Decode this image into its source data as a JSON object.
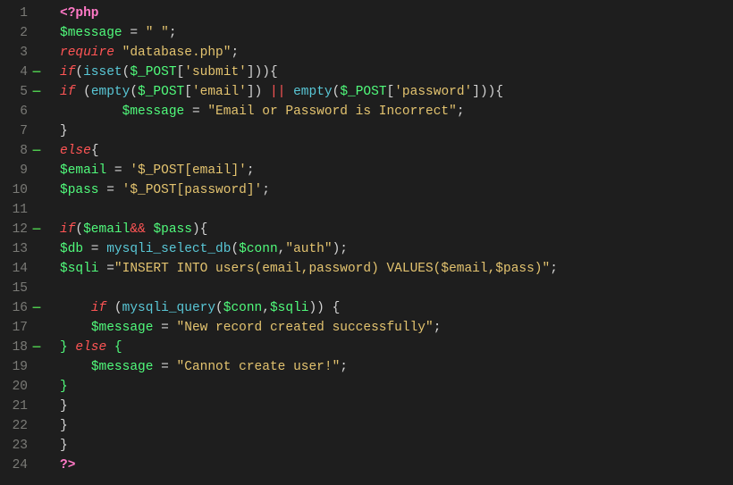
{
  "editor": {
    "language": "php",
    "lines": [
      {
        "num": 1,
        "fold": "",
        "tokens": [
          [
            "tk-tag",
            "<?php"
          ]
        ]
      },
      {
        "num": 2,
        "fold": "",
        "tokens": [
          [
            "tk-var",
            "$message"
          ],
          [
            "tk-pun",
            " = "
          ],
          [
            "tk-str",
            "\" \""
          ],
          [
            "tk-pun",
            ";"
          ]
        ]
      },
      {
        "num": 3,
        "fold": "",
        "tokens": [
          [
            "tk-kw",
            "require"
          ],
          [
            "tk-pun",
            " "
          ],
          [
            "tk-str",
            "\"database.php\""
          ],
          [
            "tk-pun",
            ";"
          ]
        ]
      },
      {
        "num": 4,
        "fold": "—",
        "tokens": [
          [
            "tk-kw",
            "if"
          ],
          [
            "tk-pun",
            "("
          ],
          [
            "tk-fn",
            "isset"
          ],
          [
            "tk-pun",
            "("
          ],
          [
            "tk-var",
            "$_POST"
          ],
          [
            "tk-pun",
            "["
          ],
          [
            "tk-str",
            "'submit'"
          ],
          [
            "tk-pun",
            "])){"
          ]
        ]
      },
      {
        "num": 5,
        "fold": "—",
        "tokens": [
          [
            "tk-kw",
            "if"
          ],
          [
            "tk-pun",
            " ("
          ],
          [
            "tk-fn",
            "empty"
          ],
          [
            "tk-pun",
            "("
          ],
          [
            "tk-var",
            "$_POST"
          ],
          [
            "tk-pun",
            "["
          ],
          [
            "tk-str",
            "'email'"
          ],
          [
            "tk-pun",
            "]) "
          ],
          [
            "tk-op",
            "||"
          ],
          [
            "tk-pun",
            " "
          ],
          [
            "tk-fn",
            "empty"
          ],
          [
            "tk-pun",
            "("
          ],
          [
            "tk-var",
            "$_POST"
          ],
          [
            "tk-pun",
            "["
          ],
          [
            "tk-str",
            "'password'"
          ],
          [
            "tk-pun",
            "])){"
          ]
        ]
      },
      {
        "num": 6,
        "fold": "",
        "tokens": [
          [
            "tk-pun",
            "        "
          ],
          [
            "tk-var",
            "$message"
          ],
          [
            "tk-pun",
            " = "
          ],
          [
            "tk-str",
            "\"Email or Password is Incorrect\""
          ],
          [
            "tk-pun",
            ";"
          ]
        ]
      },
      {
        "num": 7,
        "fold": "",
        "tokens": [
          [
            "tk-pun",
            "}"
          ]
        ]
      },
      {
        "num": 8,
        "fold": "—",
        "tokens": [
          [
            "tk-kw",
            "else"
          ],
          [
            "tk-pun",
            "{"
          ]
        ]
      },
      {
        "num": 9,
        "fold": "",
        "tokens": [
          [
            "tk-var",
            "$email"
          ],
          [
            "tk-pun",
            " = "
          ],
          [
            "tk-str",
            "'$_POST[email]'"
          ],
          [
            "tk-pun",
            ";"
          ]
        ]
      },
      {
        "num": 10,
        "fold": "",
        "tokens": [
          [
            "tk-var",
            "$pass"
          ],
          [
            "tk-pun",
            " = "
          ],
          [
            "tk-str",
            "'$_POST[password]'"
          ],
          [
            "tk-pun",
            ";"
          ]
        ]
      },
      {
        "num": 11,
        "fold": "",
        "tokens": []
      },
      {
        "num": 12,
        "fold": "—",
        "tokens": [
          [
            "tk-kw",
            "if"
          ],
          [
            "tk-pun",
            "("
          ],
          [
            "tk-var",
            "$email"
          ],
          [
            "tk-op",
            "&&"
          ],
          [
            "tk-pun",
            " "
          ],
          [
            "tk-var",
            "$pass"
          ],
          [
            "tk-pun",
            "){"
          ]
        ]
      },
      {
        "num": 13,
        "fold": "",
        "tokens": [
          [
            "tk-var",
            "$db"
          ],
          [
            "tk-pun",
            " = "
          ],
          [
            "tk-fn",
            "mysqli_select_db"
          ],
          [
            "tk-pun",
            "("
          ],
          [
            "tk-var",
            "$conn"
          ],
          [
            "tk-pun",
            ","
          ],
          [
            "tk-str",
            "\"auth\""
          ],
          [
            "tk-pun",
            ");"
          ]
        ]
      },
      {
        "num": 14,
        "fold": "",
        "tokens": [
          [
            "tk-var",
            "$sqli"
          ],
          [
            "tk-pun",
            " ="
          ],
          [
            "tk-str",
            "\"INSERT INTO users(email,password) VALUES($email,$pass)\""
          ],
          [
            "tk-pun",
            ";"
          ]
        ]
      },
      {
        "num": 15,
        "fold": "",
        "tokens": []
      },
      {
        "num": 16,
        "fold": "—",
        "tokens": [
          [
            "tk-pun",
            "    "
          ],
          [
            "tk-kw",
            "if"
          ],
          [
            "tk-pun",
            " ("
          ],
          [
            "tk-fn",
            "mysqli_query"
          ],
          [
            "tk-pun",
            "("
          ],
          [
            "tk-var",
            "$conn"
          ],
          [
            "tk-pun",
            ","
          ],
          [
            "tk-var",
            "$sqli"
          ],
          [
            "tk-pun",
            ")) {"
          ]
        ]
      },
      {
        "num": 17,
        "fold": "",
        "tokens": [
          [
            "tk-pun",
            "    "
          ],
          [
            "tk-var",
            "$message"
          ],
          [
            "tk-pun",
            " = "
          ],
          [
            "tk-str",
            "\"New record created successfully\""
          ],
          [
            "tk-pun",
            ";"
          ]
        ]
      },
      {
        "num": 18,
        "fold": "—",
        "tokens": [
          [
            "tk-var",
            "}"
          ],
          [
            "tk-pun",
            " "
          ],
          [
            "tk-kw",
            "else"
          ],
          [
            "tk-pun",
            " "
          ],
          [
            "tk-var",
            "{"
          ]
        ]
      },
      {
        "num": 19,
        "fold": "",
        "tokens": [
          [
            "tk-pun",
            "    "
          ],
          [
            "tk-var",
            "$message"
          ],
          [
            "tk-pun",
            " = "
          ],
          [
            "tk-str",
            "\"Cannot create user!\""
          ],
          [
            "tk-pun",
            ";"
          ]
        ]
      },
      {
        "num": 20,
        "fold": "",
        "tokens": [
          [
            "tk-var",
            "}"
          ]
        ]
      },
      {
        "num": 21,
        "fold": "",
        "tokens": [
          [
            "tk-pun",
            "}"
          ]
        ]
      },
      {
        "num": 22,
        "fold": "",
        "tokens": [
          [
            "tk-pun",
            "}"
          ]
        ]
      },
      {
        "num": 23,
        "fold": "",
        "tokens": [
          [
            "tk-pun",
            "}"
          ]
        ]
      },
      {
        "num": 24,
        "fold": "",
        "tokens": [
          [
            "tk-tag",
            "?>"
          ]
        ]
      }
    ]
  }
}
